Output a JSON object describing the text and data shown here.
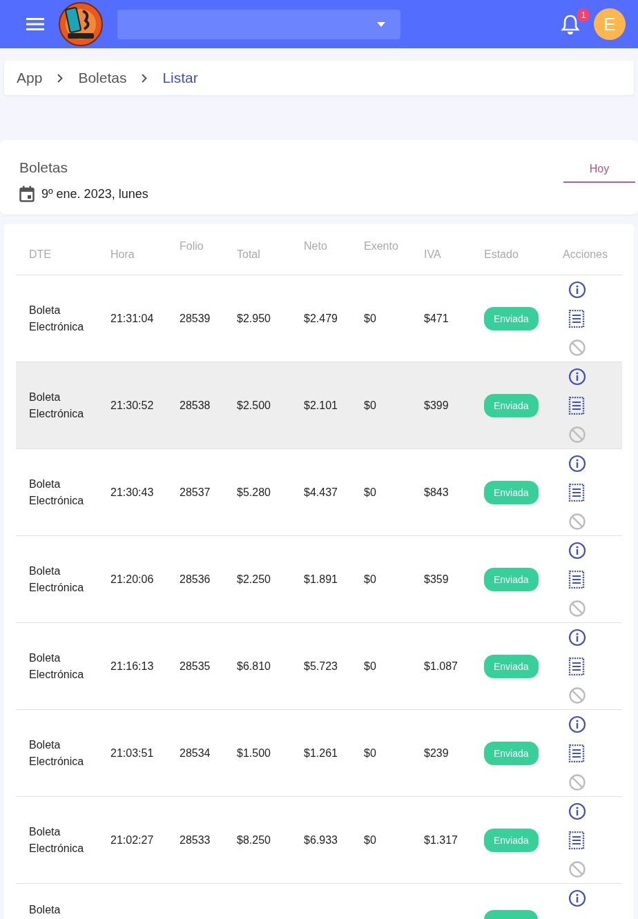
{
  "header": {
    "notification_count": "1",
    "avatar_letter": "E"
  },
  "breadcrumb": [
    {
      "label": "App",
      "selected": false
    },
    {
      "label": "Boletas",
      "selected": false
    },
    {
      "label": "Listar",
      "selected": true
    }
  ],
  "summary": {
    "title": "Boletas",
    "date": "9º ene. 2023, lunes",
    "tabs": [
      {
        "label": "Hoy",
        "selected": true
      }
    ]
  },
  "table": {
    "columns": [
      {
        "label": "DTE",
        "raised": false
      },
      {
        "label": "Hora",
        "raised": false
      },
      {
        "label": "Folio",
        "raised": true
      },
      {
        "label": "Total",
        "raised": false
      },
      {
        "label": "Neto",
        "raised": true
      },
      {
        "label": "Exento",
        "raised": true
      },
      {
        "label": "IVA",
        "raised": false
      },
      {
        "label": "Estado",
        "raised": false
      },
      {
        "label": "Acciones",
        "raised": false
      }
    ],
    "rows": [
      {
        "dte": "Boleta Electrónica",
        "hora": "21:31:04",
        "folio": "28539",
        "total": "$2.950",
        "neto": "$2.479",
        "exento": "$0",
        "iva": "$471",
        "estado": "Enviada",
        "selected": false,
        "cut": false
      },
      {
        "dte": "Boleta Electrónica",
        "hora": "21:30:52",
        "folio": "28538",
        "total": "$2.500",
        "neto": "$2.101",
        "exento": "$0",
        "iva": "$399",
        "estado": "Enviada",
        "selected": true,
        "cut": false
      },
      {
        "dte": "Boleta Electrónica",
        "hora": "21:30:43",
        "folio": "28537",
        "total": "$5.280",
        "neto": "$4.437",
        "exento": "$0",
        "iva": "$843",
        "estado": "Enviada",
        "selected": false,
        "cut": false
      },
      {
        "dte": "Boleta Electrónica",
        "hora": "21:20:06",
        "folio": "28536",
        "total": "$2.250",
        "neto": "$1.891",
        "exento": "$0",
        "iva": "$359",
        "estado": "Enviada",
        "selected": false,
        "cut": false
      },
      {
        "dte": "Boleta Electrónica",
        "hora": "21:16:13",
        "folio": "28535",
        "total": "$6.810",
        "neto": "$5.723",
        "exento": "$0",
        "iva": "$1.087",
        "estado": "Enviada",
        "selected": false,
        "cut": false
      },
      {
        "dte": "Boleta Electrónica",
        "hora": "21:03:51",
        "folio": "28534",
        "total": "$1.500",
        "neto": "$1.261",
        "exento": "$0",
        "iva": "$239",
        "estado": "Enviada",
        "selected": false,
        "cut": false
      },
      {
        "dte": "Boleta Electrónica",
        "hora": "21:02:27",
        "folio": "28533",
        "total": "$8.250",
        "neto": "$6.933",
        "exento": "$0",
        "iva": "$1.317",
        "estado": "Enviada",
        "selected": false,
        "cut": false
      },
      {
        "dte": "Boleta",
        "cut": true,
        "selected": false
      }
    ]
  }
}
